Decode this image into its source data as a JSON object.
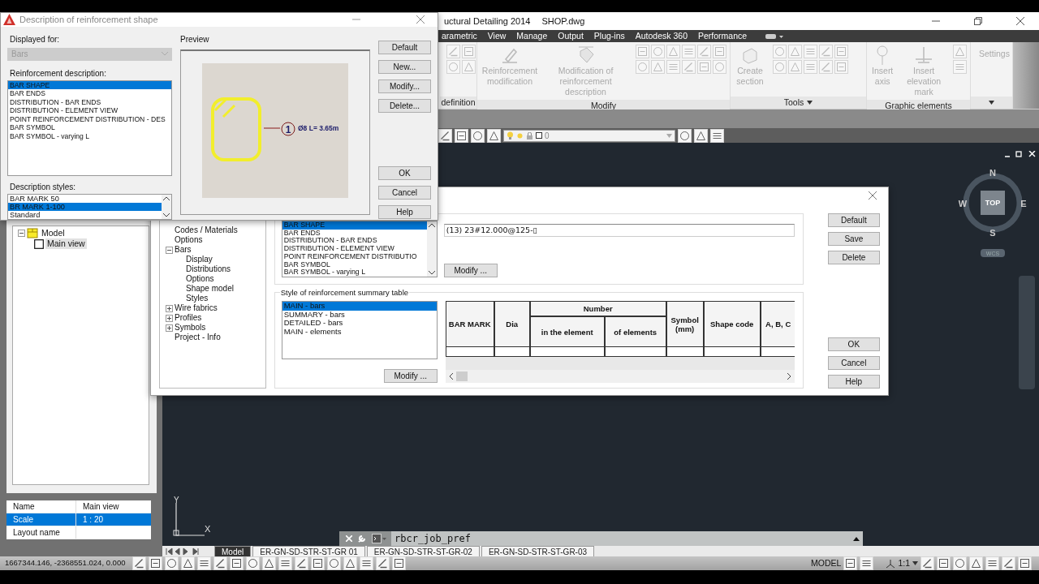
{
  "app_window": {
    "title": "uctural Detailing 2014",
    "document": "SHOP.dwg"
  },
  "ribbon": {
    "tabs": [
      "arametric",
      "View",
      "Manage",
      "Output",
      "Plug-ins",
      "Autodesk 360",
      "Performance"
    ],
    "panels": [
      {
        "kind": "icons",
        "title": "definition"
      },
      {
        "kind": "tools",
        "title": "Modify",
        "tools": [
          "Reinforcement modification",
          "Modification of reinforcement description"
        ]
      },
      {
        "kind": "tools",
        "title": "Tools",
        "menu": true,
        "tools": [
          "Create section"
        ]
      },
      {
        "kind": "tools",
        "title": "Graphic elements",
        "tools": [
          "Insert axis",
          "Insert elevation mark"
        ]
      },
      {
        "kind": "settings",
        "title": "Settings"
      }
    ]
  },
  "layer_toolbar": {
    "layer": "0"
  },
  "viewcube": {
    "north": "N",
    "south": "S",
    "east": "E",
    "west": "W",
    "face": "TOP",
    "ucs": "WCS"
  },
  "ucs_icon": {
    "x": "X",
    "y": "Y"
  },
  "project_tree": [
    {
      "label": "Model",
      "expanded": true,
      "children": [
        {
          "label": "Main view",
          "selected": true
        }
      ]
    }
  ],
  "properties": {
    "columns": [
      "Name",
      "Main view"
    ],
    "rows": [
      {
        "name": "Scale",
        "value": "1 : 20",
        "selected": true
      },
      {
        "name": "Layout name",
        "selected": false
      }
    ]
  },
  "options_dialog": {
    "tree": [
      {
        "label": "Codes / Materials"
      },
      {
        "label": "Options"
      },
      {
        "label": "Bars",
        "expanded": true,
        "children": [
          {
            "label": "Display"
          },
          {
            "label": "Distributions"
          },
          {
            "label": "Options"
          },
          {
            "label": "Shape model"
          },
          {
            "label": "Styles"
          }
        ]
      },
      {
        "label": "Wire fabrics",
        "expanded": false
      },
      {
        "label": "Profiles",
        "expanded": false
      },
      {
        "label": "Symbols",
        "expanded": false
      },
      {
        "label": "Project - Info"
      }
    ],
    "descriptions": [
      {
        "label": "BAR SHAPE",
        "selected": true
      },
      {
        "label": "BAR ENDS",
        "selected": false
      },
      {
        "label": "DISTRIBUTION - BAR ENDS",
        "selected": false
      },
      {
        "label": "DISTRIBUTION - ELEMENT VIEW",
        "selected": false
      },
      {
        "label": "POINT REINFORCEMENT DISTRIBUTIO",
        "selected": false
      },
      {
        "label": "BAR SYMBOL",
        "selected": false
      },
      {
        "label": "BAR SYMBOL - varying L",
        "selected": false
      }
    ],
    "description_text": "(13) 23#12.000@125-▯",
    "modify_button": "Modify ...",
    "summary_group": "Style of reinforcement summary table",
    "summary_styles": [
      {
        "label": "MAIN - bars",
        "selected": true
      },
      {
        "label": "SUMMARY - bars",
        "selected": false
      },
      {
        "label": "DETAILED - bars",
        "selected": false
      },
      {
        "label": "MAIN - elements",
        "selected": false
      }
    ],
    "summary_modify_button": "Modify ...",
    "table": {
      "columns": [
        {
          "label": "BAR MARK"
        },
        {
          "label": "Dia"
        },
        {
          "label": "Number",
          "children": [
            "in the element",
            "of elements"
          ]
        },
        {
          "label": "Symbol (mm)"
        },
        {
          "label": "Shape code"
        },
        {
          "label": "A, B, C"
        }
      ]
    },
    "buttons": [
      "Default",
      "Save",
      "Delete"
    ],
    "footer_buttons": [
      "OK",
      "Cancel",
      "Help"
    ]
  },
  "shape_dialog": {
    "title": "Description of reinforcement shape",
    "displayed_for": {
      "label": "Displayed for:",
      "value": "Bars",
      "disabled": true
    },
    "descriptions_label": "Reinforcement description:",
    "descriptions": [
      {
        "label": "BAR SHAPE",
        "selected": true
      },
      {
        "label": "BAR ENDS",
        "selected": false
      },
      {
        "label": "DISTRIBUTION - BAR ENDS",
        "selected": false
      },
      {
        "label": "DISTRIBUTION - ELEMENT VIEW",
        "selected": false
      },
      {
        "label": "POINT REINFORCEMENT DISTRIBUTION - DES",
        "selected": false
      },
      {
        "label": "BAR SYMBOL",
        "selected": false
      },
      {
        "label": "BAR SYMBOL - varying L",
        "selected": false
      }
    ],
    "styles_label": "Description styles:",
    "styles": [
      {
        "label": "BAR MARK 50",
        "selected": false
      },
      {
        "label": "BR MARK 1-100",
        "selected": true
      },
      {
        "label": "Standard",
        "selected": false
      }
    ],
    "preview_label": "Preview",
    "preview": {
      "mark": "1",
      "text": "Ø8 L= 3.65m"
    },
    "buttons": [
      "Default",
      "New...",
      "Modify...",
      "Delete..."
    ],
    "footer_buttons": [
      "OK",
      "Cancel",
      "Help"
    ]
  },
  "command_line": {
    "text": "rbcr_job_pref"
  },
  "layout_tabs": [
    {
      "label": "Model",
      "selected": true
    },
    {
      "label": "ER-GN-SD-STR-ST-GR 01",
      "selected": false
    },
    {
      "label": "ER-GN-SD-STR-ST-GR-02",
      "selected": false
    },
    {
      "label": "ER-GN-SD-STR-ST-GR-03",
      "selected": false
    }
  ],
  "status_bar": {
    "coordinates": "1667344.146, -2368551.024, 0.000",
    "space": "MODEL",
    "annotation_scale": "1:1"
  }
}
